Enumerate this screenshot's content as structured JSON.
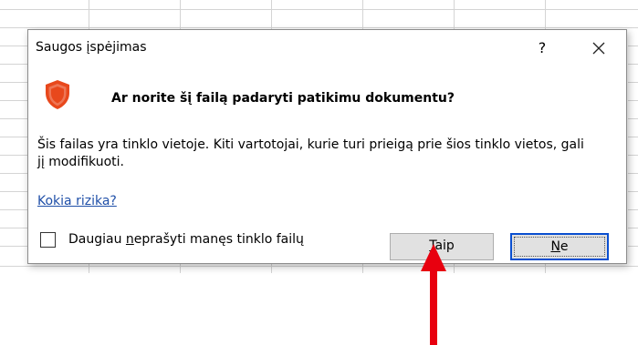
{
  "dialog": {
    "title": "Saugos įspėjimas",
    "help_label": "?",
    "question": "Ar norite šį failą padaryti patikimu dokumentu?",
    "message": "Šis failas yra tinklo vietoje. Kiti vartotojai, kurie turi prieigą prie šios tinklo vietos, gali jį modifikuoti.",
    "risk_link": "Kokia rizika?",
    "checkbox": {
      "label_before": "Daugiau ",
      "label_accel": "n",
      "label_after": "eprašyti manęs tinklo failų",
      "checked": false
    },
    "buttons": {
      "yes_accel": "T",
      "yes_rest": "aip",
      "no_accel": "N",
      "no_rest": "e"
    }
  },
  "colors": {
    "shield": "#e8481c",
    "link": "#1f4fa8",
    "default_button_border": "#0a4fd0",
    "arrow": "#e8000f"
  },
  "icons": {
    "shield": "shield-icon",
    "close": "close-icon",
    "arrow": "arrow-up-icon"
  }
}
